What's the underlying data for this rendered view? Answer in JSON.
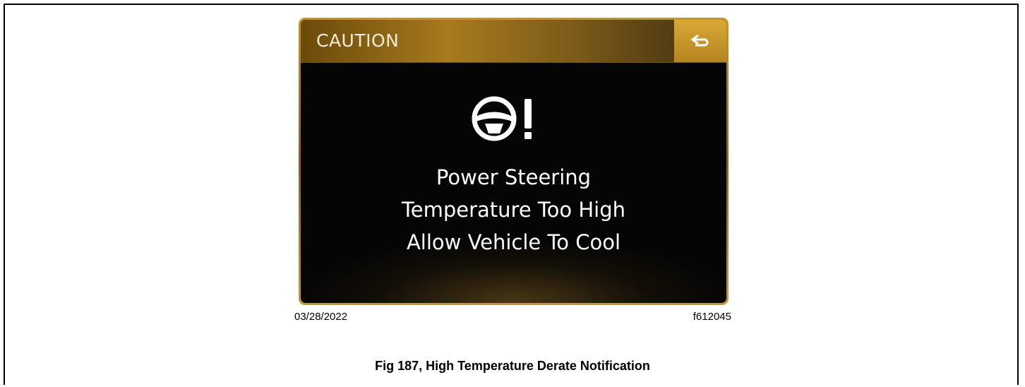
{
  "screen": {
    "header_title": "CAUTION",
    "back_button_icon": "return-arrow-icon",
    "warning_icon": "steering-wheel-warning-icon",
    "message_lines": [
      "Power Steering",
      "Temperature Too High",
      "Allow Vehicle To Cool"
    ]
  },
  "figure": {
    "date": "03/28/2022",
    "figure_id": "f612045",
    "caption": "Fig 187, High Temperature Derate Notification"
  },
  "colors": {
    "accent_gold": "#c4952a",
    "screen_background": "#050505",
    "text": "#ffffff"
  }
}
